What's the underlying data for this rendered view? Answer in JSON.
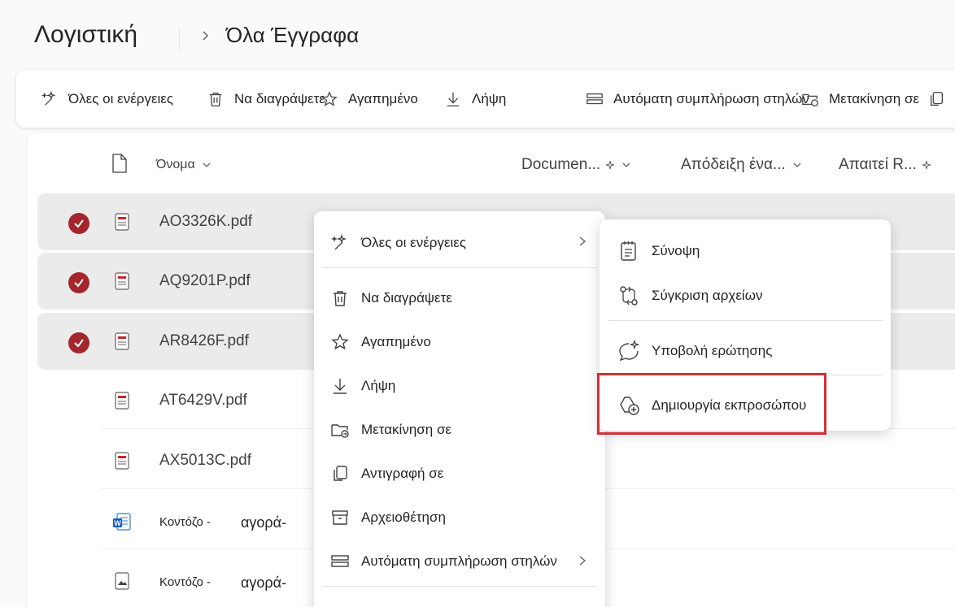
{
  "breadcrumb": {
    "root": "Λογιστική",
    "current": "Όλα Έγγραφα"
  },
  "commandbar": {
    "all_actions": "Όλες οι ενέργειες",
    "delete": "Να διαγράψετε",
    "favorite": "Αγαπημένο",
    "download": "Λήψη",
    "autofill": "Αυτόματη συμπλήρωση στηλών",
    "move_to": "Μετακίνηση σε"
  },
  "columns": {
    "name": "Όνομα",
    "document": "Documen...",
    "receipt": "Απόδειξη ένα...",
    "requires": "Απαιτεί R..."
  },
  "rows": [
    {
      "name": "AO3326K.pdf",
      "selected": true
    },
    {
      "name": "AQ9201P.pdf",
      "selected": true
    },
    {
      "name": "AR8426F.pdf",
      "selected": true
    },
    {
      "name": "AT6429V.pdf",
      "selected": false
    },
    {
      "name": "AX5013C.pdf",
      "selected": false
    },
    {
      "name": "Κοντόζο -",
      "name_suffix": "αγορά-",
      "selected": false,
      "icon": "word"
    },
    {
      "name": "Κοντόζο -",
      "name_suffix": "αγορά-",
      "selected": false,
      "icon": "image"
    }
  ],
  "context_menu": {
    "all_actions": "Όλες οι ενέργειες",
    "delete": "Να διαγράψετε",
    "favorite": "Αγαπημένο",
    "download": "Λήψη",
    "move_to": "Μετακίνηση σε",
    "copy_to": "Αντιγραφή σε",
    "archive": "Αρχειοθέτηση",
    "autofill": "Αυτόματη συμπλήρωση στηλών"
  },
  "submenu": {
    "summary": "Σύνοψη",
    "compare": "Σύγκριση αρχείων",
    "ask": "Υποβολή ερώτησης",
    "create_agent": "Δημιουργία εκπροσώπου"
  },
  "colors": {
    "accent": "#a4262c",
    "highlight": "#d32f35",
    "selected_row": "#ebebeb"
  }
}
